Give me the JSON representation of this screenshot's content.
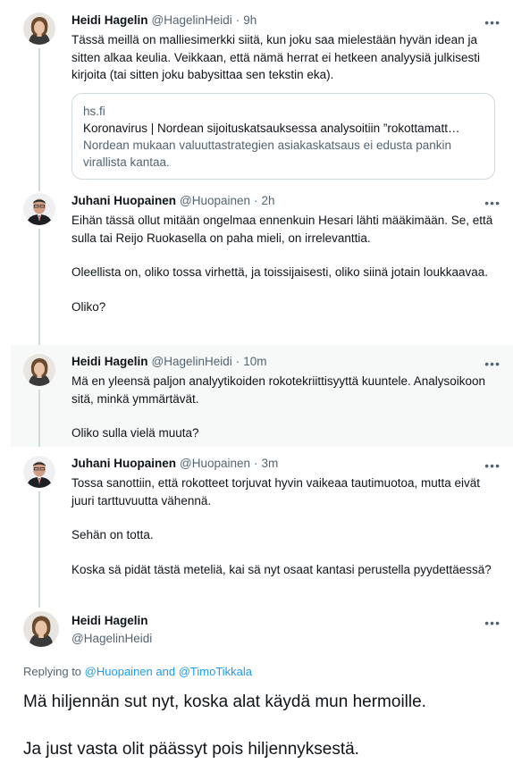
{
  "tweets": [
    {
      "name": "Heidi Hagelin",
      "handle": "@HagelinHeidi",
      "time": "9h",
      "paragraphs": [
        "Tässä meillä on malliesimerkki siitä, kun joku saa mielestään hyvän idean ja sitten alkaa keulia. Veikkaan, että nämä herrat ei hetkeen analyysiä julkisesti kirjoita (tai sitten joku babysittaa sen tekstin eka)."
      ],
      "card": {
        "domain": "hs.fi",
        "title": "Koronavirus | Nordean sijoituskatsauksessa analysoitiin ”rokottamatt…",
        "description": "Nordean mukaan valuuttastrategien asiakaskatsaus ei edusta pankin virallista kantaa."
      }
    },
    {
      "name": "Juhani Huopainen",
      "handle": "@Huopainen",
      "time": "2h",
      "paragraphs": [
        "Eihän tässä ollut mitään ongelmaa ennenkuin Hesari lähti määkimään. Se, että sulla tai Reijo Ruokasella on paha mieli, on irrelevanttia.",
        "Oleellista on, oliko tossa virhettä, ja toissijaisesti, oliko siinä jotain loukkaavaa.",
        "Oliko?"
      ]
    },
    {
      "name": "Heidi Hagelin",
      "handle": "@HagelinHeidi",
      "time": "10m",
      "paragraphs": [
        "Mä en yleensä paljon analyytikoiden rokotekriittisyyttä kuuntele. Analysoikoon sitä, minkä ymmärtävät.",
        "Oliko sulla vielä muuta?"
      ]
    },
    {
      "name": "Juhani Huopainen",
      "handle": "@Huopainen",
      "time": "3m",
      "paragraphs": [
        "Tossa sanottiin, että rokotteet torjuvat hyvin vaikeaa tautimuotoa, mutta eivät juuri tarttuvuutta vähennä.",
        "Sehän on totta.",
        "Koska sä pidät tästä meteliä, kai sä nyt osaat kantasi perustella pyydettäessä?"
      ]
    }
  ],
  "focus": {
    "name": "Heidi Hagelin",
    "handle": "@HagelinHeidi",
    "replying_label": "Replying to",
    "replying_to_1": "@Huopainen",
    "replying_and": "and",
    "replying_to_2": "@TimoTikkala",
    "paragraphs": [
      "Mä hiljennän sut nyt, koska alat käydä mun hermoille.",
      "Ja just vasta olit päässyt pois hiljennyksestä."
    ]
  },
  "ui": {
    "more_glyph": "•••",
    "separator": "·"
  },
  "colors": {
    "link": "#1d9bf0",
    "secondary_text": "#536471",
    "highlight_bg": "#f7f9f9"
  }
}
